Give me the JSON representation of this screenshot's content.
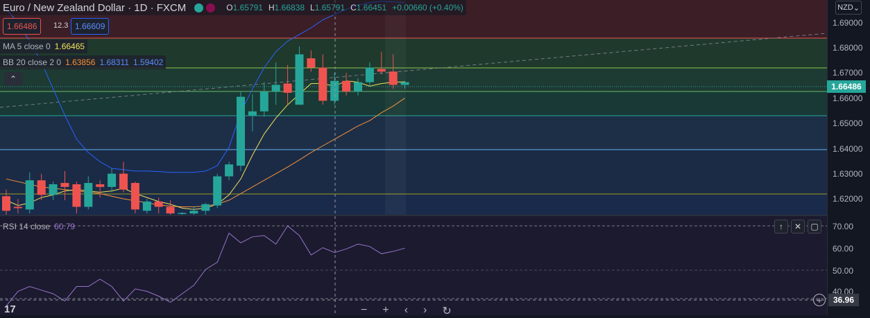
{
  "header": {
    "title": "Euro / New Zealand Dollar · 1D · FXCM",
    "ohlc": {
      "o_label": "O",
      "o": "1.65791",
      "h_label": "H",
      "h": "1.66838",
      "l_label": "L",
      "l": "1.65791",
      "c_label": "C",
      "c": "1.66451",
      "change": "+0.00660 (+0.40%)"
    }
  },
  "trade": {
    "sell": "1.66486",
    "spread": "12.3",
    "buy": "1.66609"
  },
  "indicators": {
    "ma": {
      "label": "MA 5 close 0",
      "value": "1.66465"
    },
    "bb": {
      "label": "BB 20 close 2 0",
      "basis": "1.63856",
      "upper": "1.68311",
      "lower": "1.59402"
    },
    "rsi": {
      "label": "RSI 14 close",
      "value": "60.79"
    }
  },
  "collapse_icon": "chevron-up-icon",
  "currency": "NZD",
  "price_axis": [
    "1.69000",
    "1.68000",
    "1.67000",
    "1.66000",
    "1.65000",
    "1.64000",
    "1.63000",
    "1.62000"
  ],
  "rsi_axis": [
    "70.00",
    "60.00",
    "50.00",
    "40.00"
  ],
  "current_price": "1.66486",
  "crosshair_value": "36.96",
  "nav_icons": [
    "minus-icon",
    "plus-icon",
    "chevron-left-icon",
    "chevron-right-icon",
    "reset-icon"
  ],
  "colors": {
    "up": "#26a69a",
    "down": "#ef5350",
    "ma": "#f0e35b",
    "bb_basis": "#f7923b",
    "bb_band": "#2962ff",
    "rsi": "#9575cd"
  },
  "chart_data": {
    "type": "candlestick",
    "ylim": [
      1.6145,
      1.6955
    ],
    "candles": [
      {
        "o": 1.6215,
        "h": 1.624,
        "l": 1.6145,
        "c": 1.616
      },
      {
        "o": 1.6175,
        "h": 1.6205,
        "l": 1.615,
        "c": 1.617
      },
      {
        "o": 1.6165,
        "h": 1.6305,
        "l": 1.615,
        "c": 1.6275
      },
      {
        "o": 1.6275,
        "h": 1.63,
        "l": 1.62,
        "c": 1.622
      },
      {
        "o": 1.622,
        "h": 1.627,
        "l": 1.62,
        "c": 1.626
      },
      {
        "o": 1.6265,
        "h": 1.631,
        "l": 1.62,
        "c": 1.625
      },
      {
        "o": 1.626,
        "h": 1.627,
        "l": 1.615,
        "c": 1.6175
      },
      {
        "o": 1.6175,
        "h": 1.629,
        "l": 1.6165,
        "c": 1.6265
      },
      {
        "o": 1.626,
        "h": 1.6275,
        "l": 1.621,
        "c": 1.625
      },
      {
        "o": 1.625,
        "h": 1.632,
        "l": 1.623,
        "c": 1.63
      },
      {
        "o": 1.63,
        "h": 1.6345,
        "l": 1.623,
        "c": 1.624
      },
      {
        "o": 1.6265,
        "h": 1.627,
        "l": 1.615,
        "c": 1.6165
      },
      {
        "o": 1.616,
        "h": 1.6205,
        "l": 1.615,
        "c": 1.6195
      },
      {
        "o": 1.6195,
        "h": 1.621,
        "l": 1.615,
        "c": 1.6175
      },
      {
        "o": 1.6175,
        "h": 1.62,
        "l": 1.6145,
        "c": 1.615
      },
      {
        "o": 1.615,
        "h": 1.6155,
        "l": 1.6145,
        "c": 1.6152
      },
      {
        "o": 1.615,
        "h": 1.6175,
        "l": 1.6145,
        "c": 1.616
      },
      {
        "o": 1.616,
        "h": 1.619,
        "l": 1.6145,
        "c": 1.6185
      },
      {
        "o": 1.618,
        "h": 1.63,
        "l": 1.617,
        "c": 1.629
      },
      {
        "o": 1.629,
        "h": 1.6345,
        "l": 1.6275,
        "c": 1.6335
      },
      {
        "o": 1.633,
        "h": 1.661,
        "l": 1.631,
        "c": 1.659
      },
      {
        "o": 1.652,
        "h": 1.66,
        "l": 1.646,
        "c": 1.6535
      },
      {
        "o": 1.6535,
        "h": 1.6645,
        "l": 1.6515,
        "c": 1.661
      },
      {
        "o": 1.661,
        "h": 1.672,
        "l": 1.656,
        "c": 1.6635
      },
      {
        "o": 1.664,
        "h": 1.671,
        "l": 1.656,
        "c": 1.6605
      },
      {
        "o": 1.656,
        "h": 1.678,
        "l": 1.656,
        "c": 1.675
      },
      {
        "o": 1.6735,
        "h": 1.6765,
        "l": 1.6685,
        "c": 1.67
      },
      {
        "o": 1.67,
        "h": 1.675,
        "l": 1.656,
        "c": 1.6575
      },
      {
        "o": 1.6575,
        "h": 1.668,
        "l": 1.656,
        "c": 1.665
      },
      {
        "o": 1.665,
        "h": 1.668,
        "l": 1.6595,
        "c": 1.661
      },
      {
        "o": 1.661,
        "h": 1.666,
        "l": 1.6595,
        "c": 1.6645
      },
      {
        "o": 1.6645,
        "h": 1.672,
        "l": 1.663,
        "c": 1.67
      },
      {
        "o": 1.6695,
        "h": 1.676,
        "l": 1.6675,
        "c": 1.6685
      },
      {
        "o": 1.6685,
        "h": 1.675,
        "l": 1.662,
        "c": 1.6635
      },
      {
        "o": 1.6635,
        "h": 1.665,
        "l": 1.662,
        "c": 1.6645
      }
    ],
    "ma5": [
      1.62,
      1.618,
      1.619,
      1.621,
      1.622,
      1.6235,
      1.624,
      1.6235,
      1.623,
      1.6235,
      1.6245,
      1.6225,
      1.621,
      1.6195,
      1.6185,
      1.617,
      1.6165,
      1.617,
      1.6185,
      1.622,
      1.628,
      1.637,
      1.645,
      1.651,
      1.656,
      1.66,
      1.664,
      1.664,
      1.663,
      1.665,
      1.6645,
      1.663,
      1.664,
      1.6645,
      1.66465
    ],
    "bb_basis": [
      1.628,
      1.627,
      1.626,
      1.625,
      1.6245,
      1.624,
      1.6235,
      1.623,
      1.6225,
      1.6215,
      1.6205,
      1.6198,
      1.619,
      1.6182,
      1.6178,
      1.6175,
      1.6175,
      1.6178,
      1.6185,
      1.62,
      1.6225,
      1.625,
      1.6275,
      1.63,
      1.6325,
      1.6352,
      1.638,
      1.6405,
      1.643,
      1.6455,
      1.648,
      1.65,
      1.653,
      1.6555,
      1.6585
    ],
    "bb_upper": [
      1.692,
      1.687,
      1.68,
      1.672,
      1.662,
      1.652,
      1.643,
      1.638,
      1.6345,
      1.632,
      1.6315,
      1.631,
      1.631,
      1.6308,
      1.6305,
      1.6305,
      1.6305,
      1.631,
      1.633,
      1.64,
      1.653,
      1.662,
      1.67,
      1.676,
      1.68,
      1.6825,
      1.685,
      1.688,
      1.69,
      1.692,
      1.6935,
      1.6945,
      1.695,
      1.6948,
      1.6945
    ],
    "rsi": [
      36.96,
      43.0,
      45.0,
      43.5,
      42.0,
      39.0,
      45.0,
      45.0,
      48.0,
      45.0,
      39.0,
      44.0,
      43.0,
      41.0,
      38.5,
      42.0,
      45.5,
      52.0,
      55.0,
      67.0,
      63.0,
      65.5,
      66.0,
      62.5,
      70.0,
      66.0,
      58.0,
      61.0,
      59.0,
      60.5,
      62.5,
      61.5,
      58.5,
      59.5,
      60.79
    ],
    "rsi_ylim": [
      30,
      80
    ]
  }
}
